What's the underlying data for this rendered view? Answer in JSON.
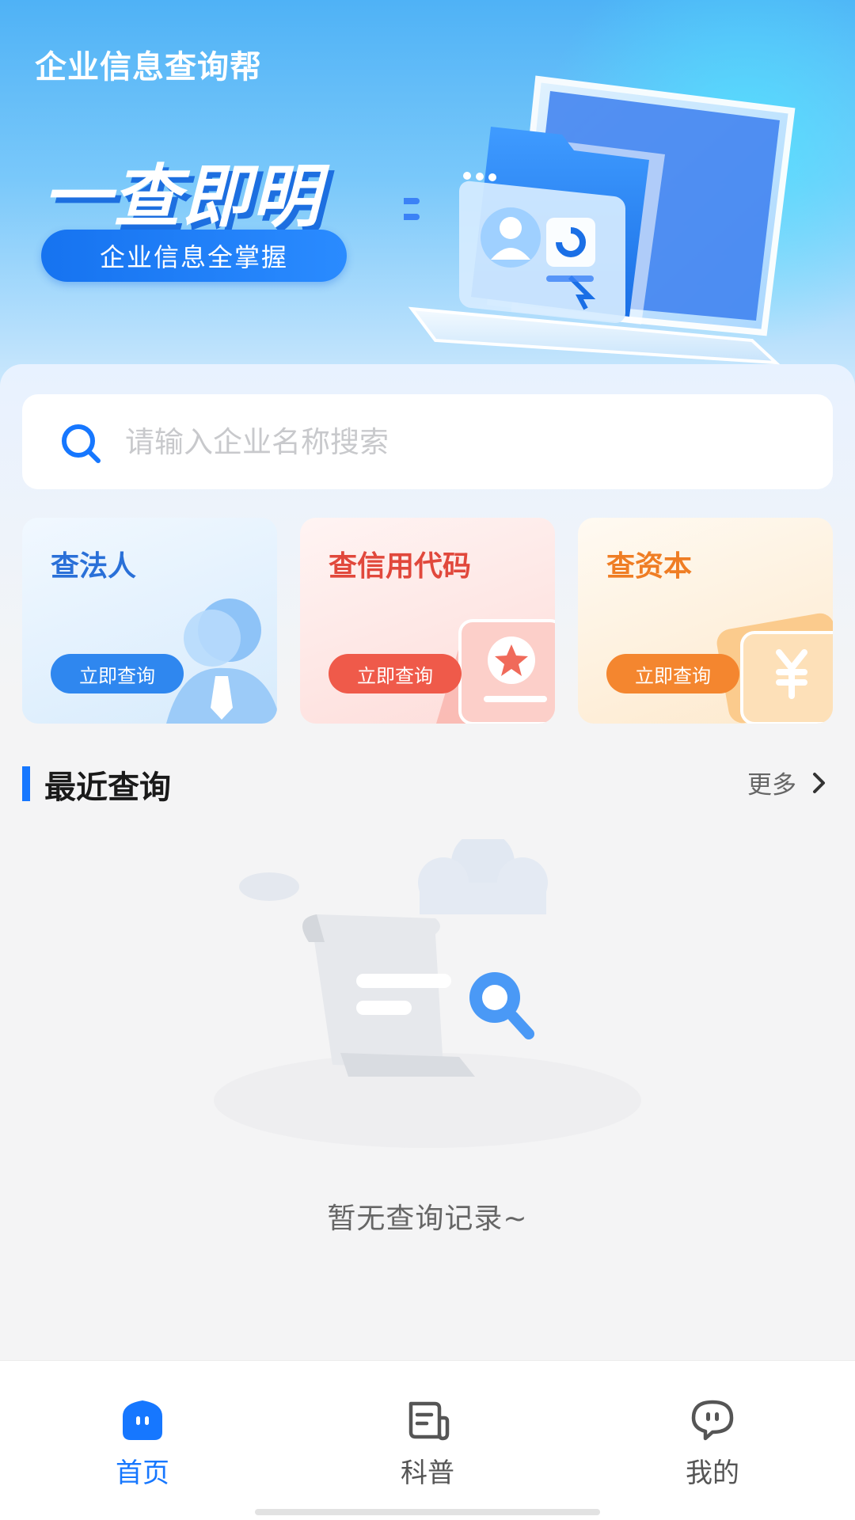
{
  "header": {
    "app_title": "企业信息查询帮",
    "slogan": "一查即明",
    "pill_text": "企业信息全掌握"
  },
  "search": {
    "placeholder": "请输入企业名称搜索",
    "icon": "search-icon"
  },
  "cards": [
    {
      "title": "查法人",
      "button": "立即查询",
      "accent": "#2f87ef",
      "icon": "person-icon"
    },
    {
      "title": "查信用代码",
      "button": "立即查询",
      "accent": "#ef5a4a",
      "icon": "certificate-icon"
    },
    {
      "title": "查资本",
      "button": "立即查询",
      "accent": "#f4862f",
      "icon": "yuan-icon"
    }
  ],
  "recent": {
    "title": "最近查询",
    "more_label": "更多",
    "empty_text": "暂无查询记录~"
  },
  "tabbar": {
    "items": [
      {
        "label": "首页",
        "icon": "home-icon",
        "active": true
      },
      {
        "label": "科普",
        "icon": "article-icon",
        "active": false
      },
      {
        "label": "我的",
        "icon": "chat-face-icon",
        "active": false
      }
    ],
    "active_color": "#1677ff"
  },
  "colors": {
    "brand": "#1677ff",
    "banner_top": "#4fb2f6",
    "background": "#f4f4f5"
  }
}
